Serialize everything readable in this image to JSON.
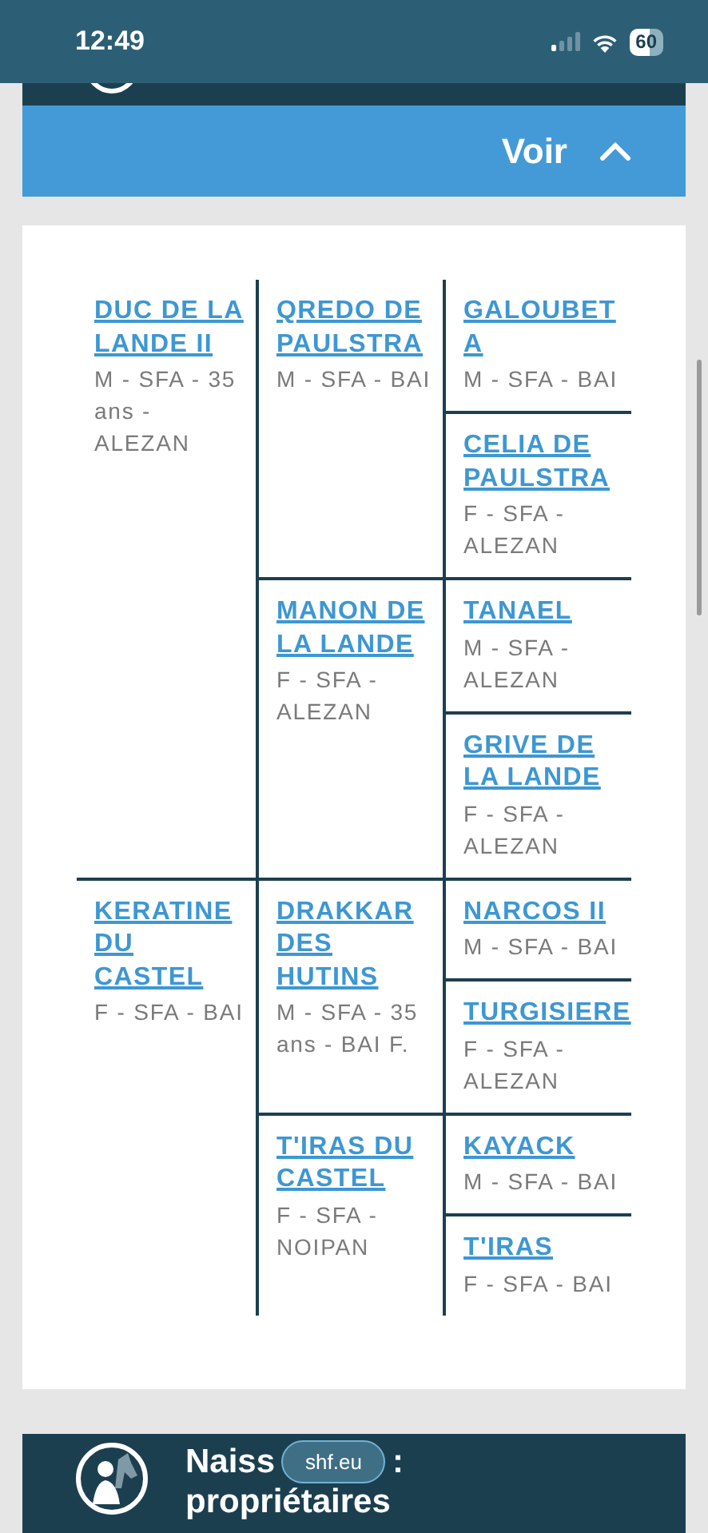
{
  "status_bar": {
    "time": "12:49",
    "battery": "60"
  },
  "toggle": {
    "label": "Voir",
    "expanded": true
  },
  "pedigree": {
    "generations": [
      [
        {
          "name": "DUC DE LA LANDE II",
          "info": "M - SFA - 35 ans - ALEZAN"
        },
        {
          "name": "KERATINE DU CASTEL",
          "info": "F - SFA - BAI"
        }
      ],
      [
        {
          "name": "QREDO DE PAULSTRA",
          "info": "M - SFA - BAI"
        },
        {
          "name": "MANON DE LA LANDE",
          "info": "F - SFA - ALEZAN"
        },
        {
          "name": "DRAKKAR DES HUTINS",
          "info": "M - SFA - 35 ans - BAI F."
        },
        {
          "name": "T'IRAS DU CASTEL",
          "info": "F - SFA - NOIPAN"
        }
      ],
      [
        {
          "name": "GALOUBET A",
          "info": "M - SFA - BAI"
        },
        {
          "name": "CELIA DE PAULSTRA",
          "info": "F - SFA - ALEZAN"
        },
        {
          "name": "TANAEL",
          "info": "M - SFA - ALEZAN"
        },
        {
          "name": "GRIVE DE LA LANDE",
          "info": "F - SFA - ALEZAN"
        },
        {
          "name": "NARCOS II",
          "info": "M - SFA - BAI"
        },
        {
          "name": "TURGISIERE",
          "info": "F - SFA - ALEZAN"
        },
        {
          "name": "KAYACK",
          "info": "M - SFA - BAI"
        },
        {
          "name": "T'IRAS",
          "info": "F - SFA - BAI"
        }
      ]
    ]
  },
  "next_section": {
    "title_start": "Naiss",
    "title_end": ":",
    "title_line_2": "propriétaires"
  },
  "url_pill": "shf.eu"
}
